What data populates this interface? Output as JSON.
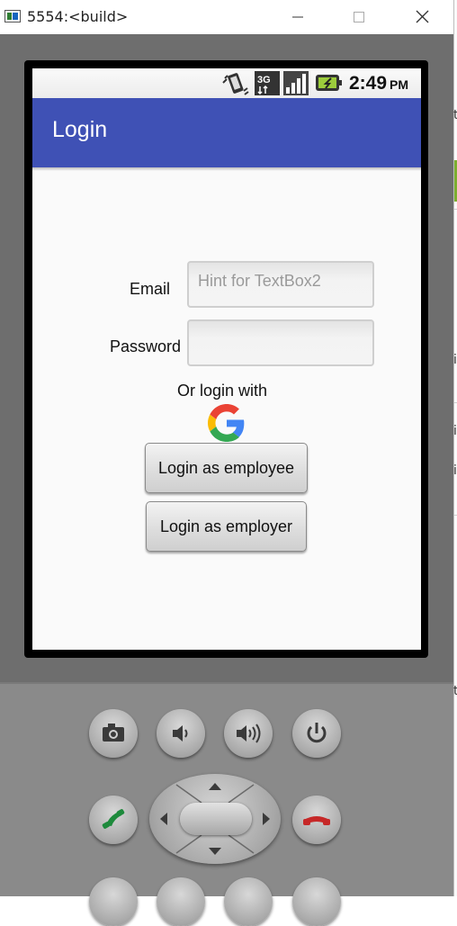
{
  "window": {
    "title": "5554:<build>"
  },
  "statusbar": {
    "time": "2:49",
    "ampm": "PM",
    "icons": [
      "vibrate-icon",
      "3g-icon",
      "signal-icon",
      "battery-icon"
    ]
  },
  "app": {
    "title": "Login",
    "accent": "#3f51b5"
  },
  "form": {
    "email_label": "Email",
    "email_hint": "Hint for TextBox2",
    "password_label": "Password",
    "password_value": "",
    "or_login_with": "Or login with",
    "employee_button": "Login as employee",
    "employer_button": "Login as employer"
  },
  "hardware": {
    "buttons": [
      "camera-icon",
      "volume-down-icon",
      "volume-up-icon",
      "power-icon",
      "call-icon",
      "dpad",
      "end-call-icon"
    ]
  },
  "background_window": {
    "fragments": [
      "t",
      "i",
      "i",
      "i",
      "t"
    ]
  }
}
